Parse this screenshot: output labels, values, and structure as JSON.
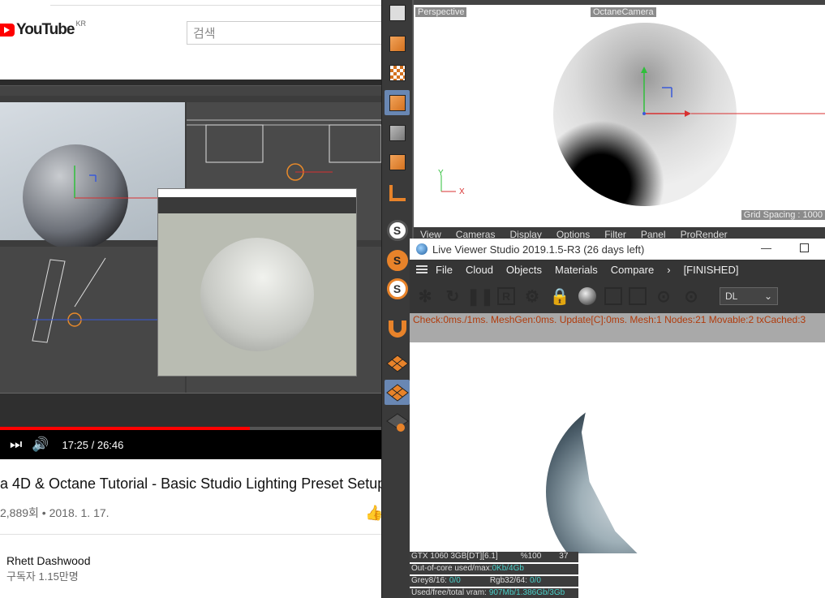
{
  "youtube": {
    "logo_text": "YouTube",
    "region": "KR",
    "search_placeholder": "검색",
    "time_display": "17:25 / 26:46",
    "progress_fraction": 0.6555,
    "video_title": "a 4D & Octane Tutorial - Basic Studio Lighting Preset Setup",
    "meta": "2,889회 • 2018. 1. 17.",
    "channel_name": "Rhett Dashwood",
    "subscribers": "구독자 1.15만명"
  },
  "palette": {
    "icons": [
      "cube-object-icon",
      "checker-cube-icon",
      "cube-axis-icon",
      "cube-icon",
      "orange-cube-icon",
      "axis-icon",
      "octane-s-icon",
      "octane-s-orange-icon",
      "octane-s-white-icon",
      "magnet-icon",
      "plane-icon",
      "grid-icon",
      "lock-grid-icon"
    ]
  },
  "viewport": {
    "label_left": "Perspective",
    "label_camera": "OctaneCamera",
    "grid_spacing": "Grid Spacing : 1000",
    "menu": [
      "View",
      "Cameras",
      "Display",
      "Options",
      "Filter",
      "Panel",
      "ProRender"
    ],
    "axis_y": "Y",
    "axis_x": "X"
  },
  "live_viewer": {
    "title": "Live Viewer Studio 2019.1.5-R3 (26 days left)",
    "minimize": "—",
    "menu": [
      "File",
      "Cloud",
      "Objects",
      "Materials",
      "Compare"
    ],
    "finished": "[FINISHED]",
    "select_value": "DL",
    "status": "Check:0ms./1ms. MeshGen:0ms. Update[C]:0ms. Mesh:1 Nodes:21 Movable:2 txCached:3",
    "gpu": "GTX 1060 3GB[DT][6.1]",
    "gpu_percent": "%100",
    "gpu_temp": "37",
    "ooc_label": "Out-of-core used/max:",
    "ooc_value": "0Kb/4Gb",
    "grey_label": "Grey8/16:",
    "grey_value": "0/0",
    "rgb_label": "Rgb32/64:",
    "rgb_value": "0/0",
    "vram_label": "Used/free/total vram:",
    "vram_value": "907Mb/1.386Gb/3Gb"
  }
}
